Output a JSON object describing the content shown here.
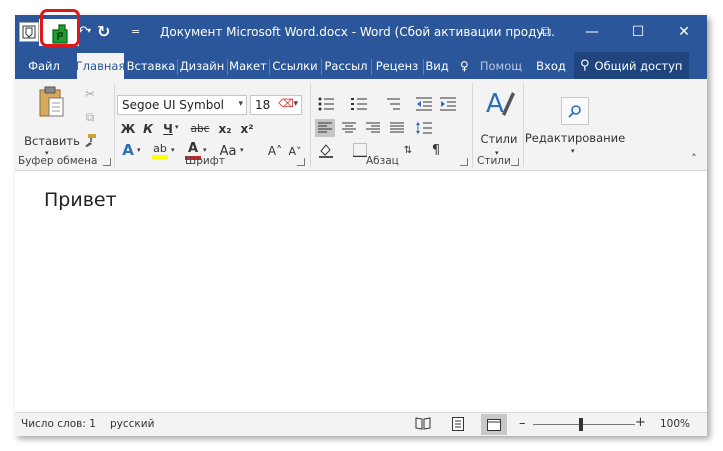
{
  "window": {
    "title": "Документ Microsoft Word.docx - Word (Сбой активации проду...",
    "controls": {
      "ribbon_display": "⧉",
      "minimize": "—",
      "maximize": "☐",
      "close": "✕"
    }
  },
  "qat": {
    "customize": "="
  },
  "tabs": [
    {
      "label": "Файл"
    },
    {
      "label": "Главная"
    },
    {
      "label": "Вставка"
    },
    {
      "label": "Дизайн"
    },
    {
      "label": "Макет"
    },
    {
      "label": "Ссылки"
    },
    {
      "label": "Рассыл"
    },
    {
      "label": "Реценз"
    },
    {
      "label": "Вид"
    }
  ],
  "tell_me": "Помощ",
  "signin": "Вход",
  "share": "Общий доступ",
  "ribbon": {
    "clipboard": {
      "paste_label": "Вставить",
      "group_label": "Буфер обмена"
    },
    "font": {
      "font_name": "Segoe UI Symbol",
      "font_size": "18",
      "bold": "Ж",
      "italic": "К",
      "underline": "Ч",
      "strike": "abc",
      "subscript": "x₂",
      "superscript": "x²",
      "grow": "A˄",
      "shrink": "A˅",
      "case": "Aa",
      "effects": "A",
      "highlight": "ab",
      "color": "A",
      "group_label": "Шрифт"
    },
    "paragraph": {
      "pilcrow": "¶",
      "group_label": "Абзац"
    },
    "styles": {
      "styles_label": "Стили",
      "group_label": "Стили"
    },
    "editing": {
      "editing_label": "Редактирование"
    }
  },
  "document": {
    "text": "Привет"
  },
  "status": {
    "word_count": "Число слов: 1",
    "language": "русский",
    "zoom": "100%",
    "zoom_minus": "–",
    "zoom_plus": "+"
  },
  "colors": {
    "accent": "#2b579a",
    "ribbon_bg": "#f3f3f3",
    "highlight_ring": "#e11616",
    "icon_green": "#1e9e2e"
  }
}
